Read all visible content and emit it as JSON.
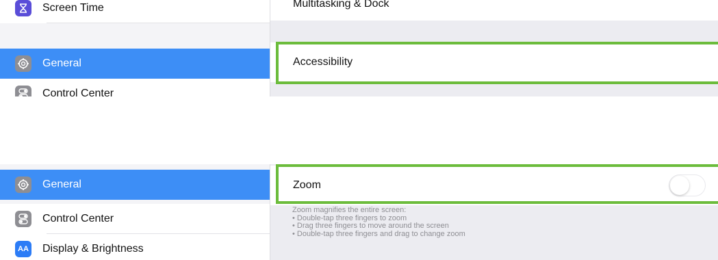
{
  "top": {
    "sidebar_items": [
      {
        "label": "Screen Time",
        "icon": "hourglass-icon"
      },
      {
        "label": "General",
        "icon": "gear-icon",
        "selected": true
      },
      {
        "label": "Control Center",
        "icon": "switches-icon"
      }
    ],
    "content_rows": [
      {
        "label": "Multitasking & Dock"
      },
      {
        "label": "Accessibility",
        "highlighted": true
      }
    ]
  },
  "bottom": {
    "sidebar_items": [
      {
        "label": "General",
        "icon": "gear-icon",
        "selected": true
      },
      {
        "label": "Control Center",
        "icon": "switches-icon"
      },
      {
        "label": "Display & Brightness",
        "icon": "aa-icon",
        "icon_text": "AA"
      }
    ],
    "zoom_row": {
      "label": "Zoom",
      "highlighted": true,
      "toggle_on": false
    },
    "zoom_description": {
      "heading": "Zoom magnifies the entire screen:",
      "bullets": [
        "• Double-tap three fingers to zoom",
        "• Drag three fingers to move around the screen",
        "• Double-tap three fingers and drag to change zoom"
      ]
    }
  },
  "colors": {
    "selected": "#3d8ef6",
    "highlight_border": "#6cbc3c",
    "sidebar_bg": "#f4f4f7",
    "content_bg": "#ececf1"
  }
}
